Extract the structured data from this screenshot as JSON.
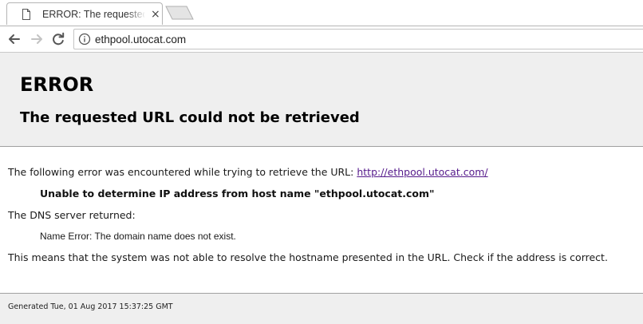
{
  "browser": {
    "tab": {
      "title": "ERROR: The requested U",
      "close_glyph": "×",
      "icon": "document-icon"
    },
    "new_tab_icon": "new-tab-icon",
    "toolbar": {
      "back_icon": "back-arrow-icon",
      "forward_icon": "forward-arrow-icon",
      "reload_icon": "reload-icon",
      "site_info_icon": "info-icon",
      "url": "ethpool.utocat.com"
    }
  },
  "page": {
    "heading": "ERROR",
    "subheading": "The requested URL could not be retrieved",
    "error_intro": "The following error was encountered while trying to retrieve the URL: ",
    "error_link": "http://ethpool.utocat.com/",
    "error_detail": "Unable to determine IP address from host name \"ethpool.utocat.com\"",
    "dns_label": "The DNS server returned:",
    "dns_message": "Name Error: The domain name does not exist.",
    "explanation": "This means that the system was not able to resolve the hostname presented in the URL. Check if the address is correct.",
    "footer": "Generated Tue, 01 Aug 2017 15:37:25 GMT"
  },
  "colors": {
    "header_bg": "#efefef",
    "link_visited": "#551a8b",
    "rule": "#a0a0a0"
  }
}
